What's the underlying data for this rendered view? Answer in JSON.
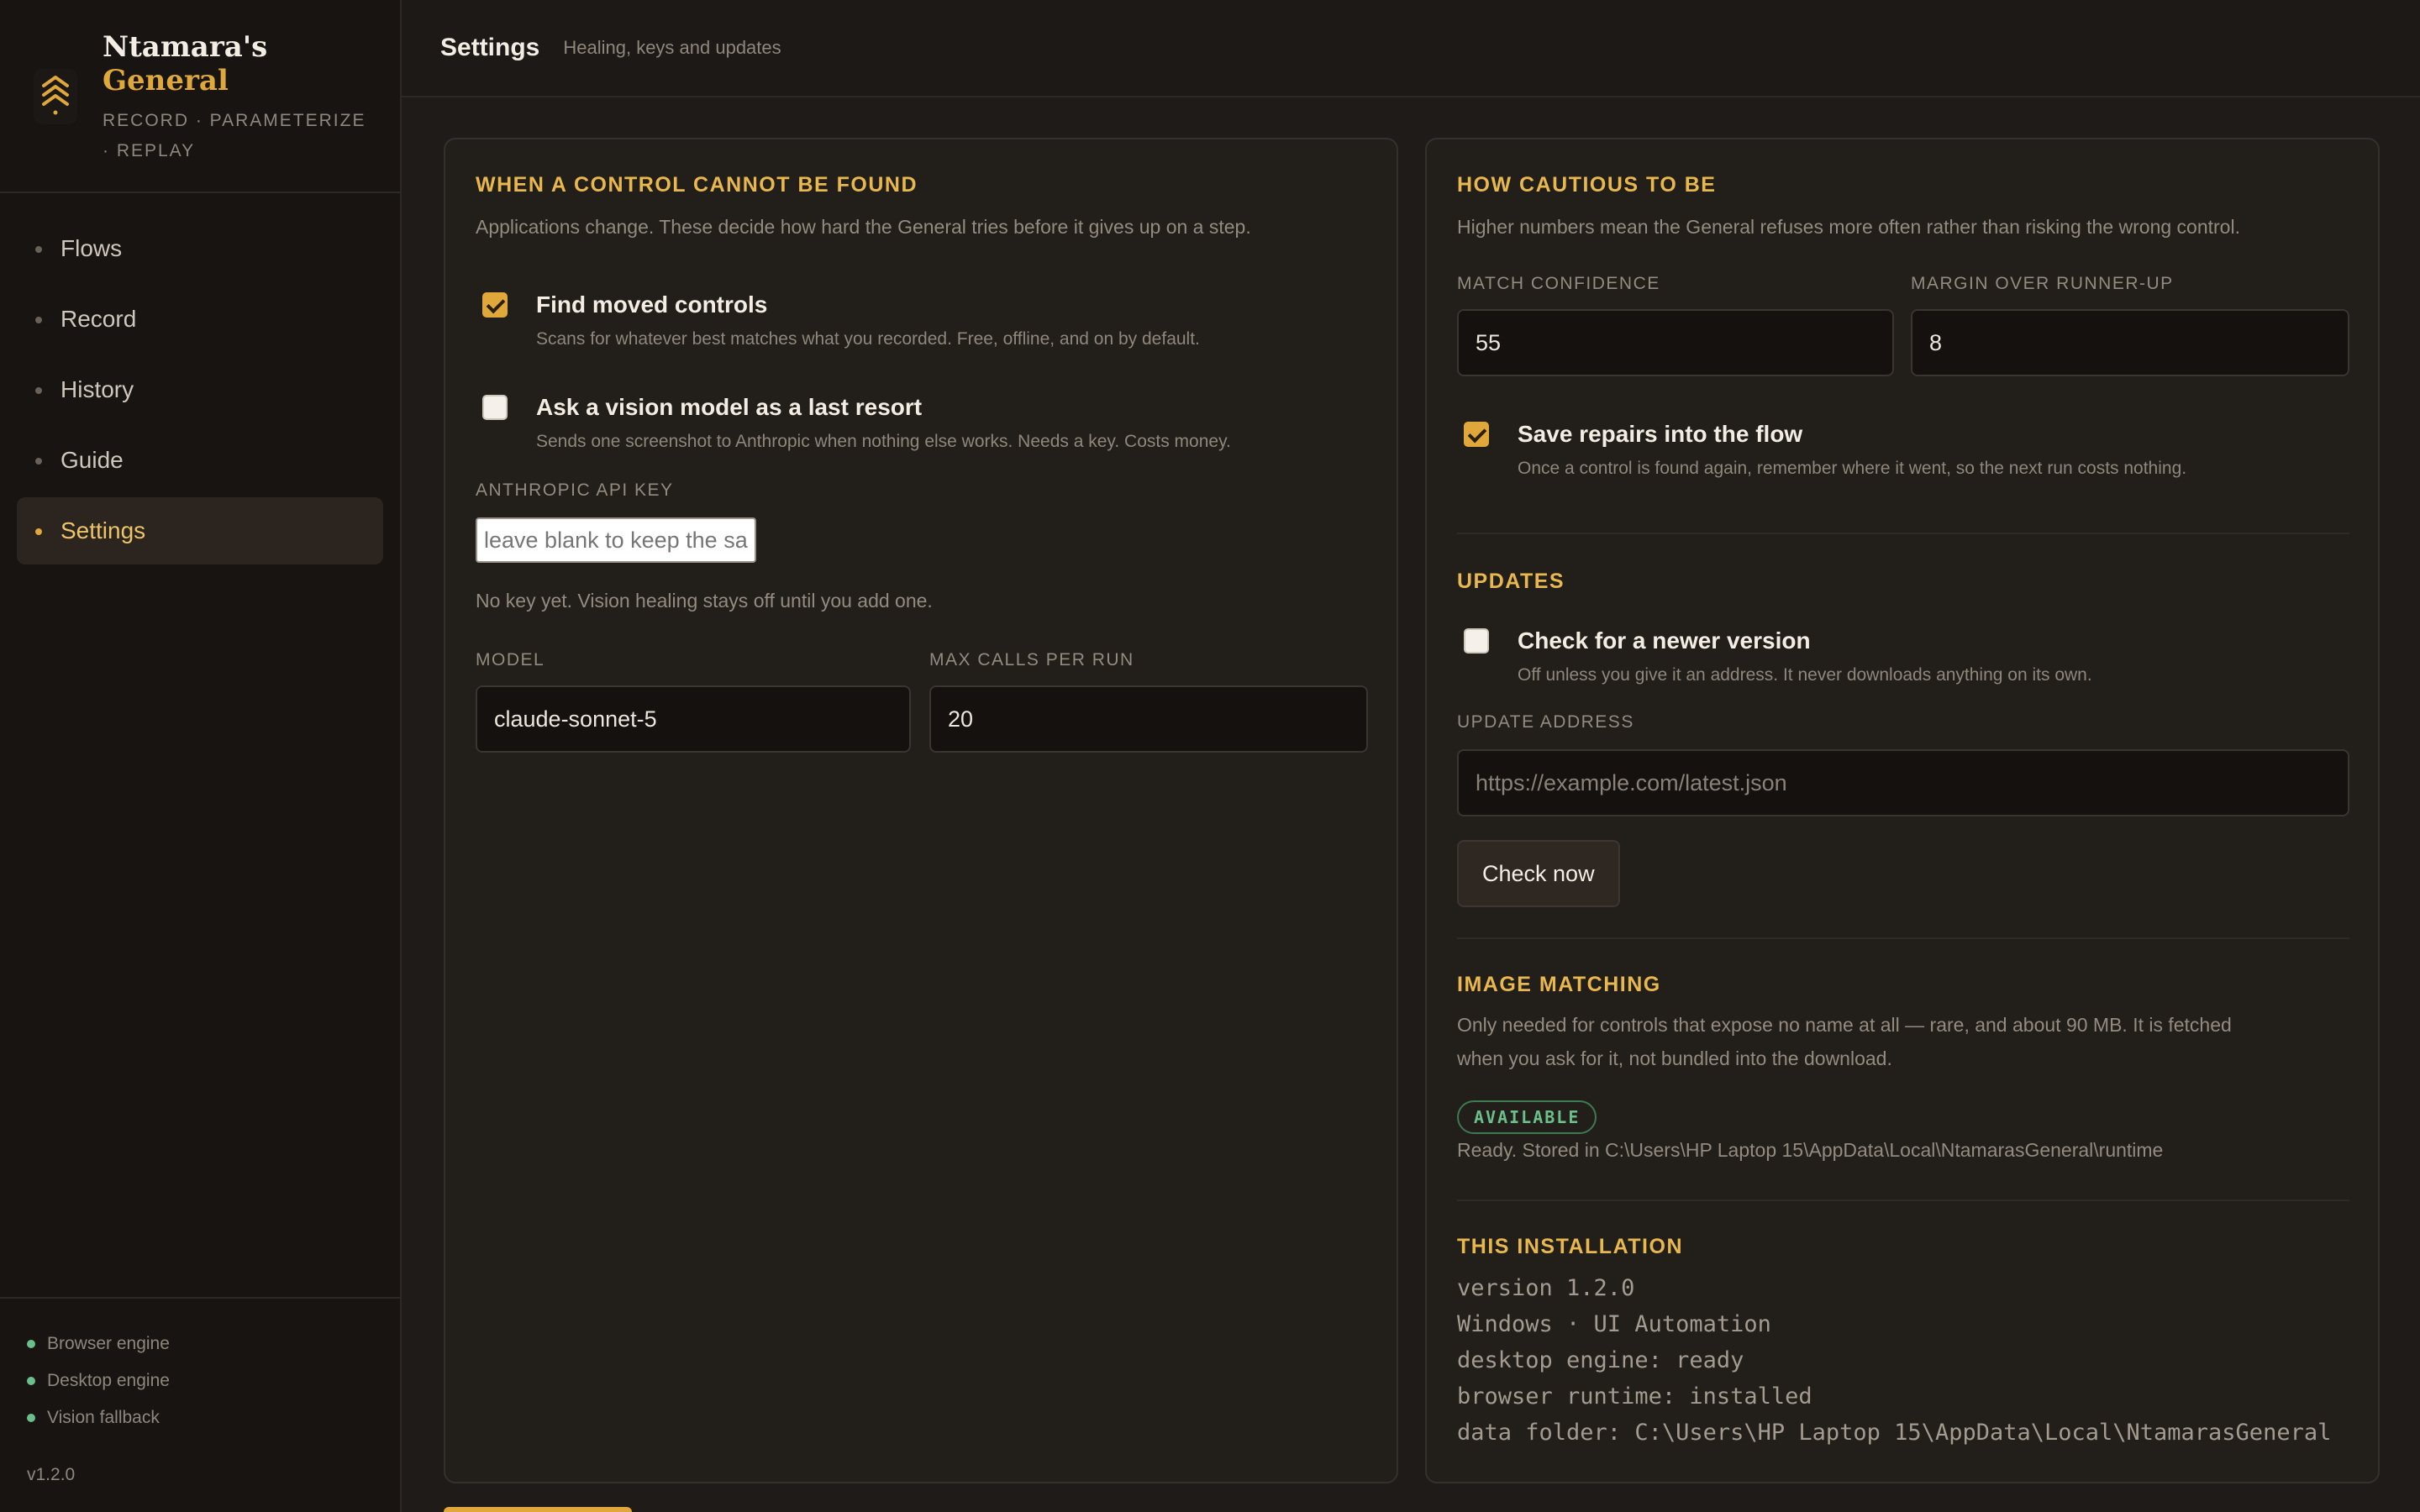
{
  "brand": {
    "name_line1": "Ntamara's",
    "name_line2": "General",
    "tagline": "RECORD · PARAMETERIZE · REPLAY"
  },
  "nav": {
    "items": [
      {
        "label": "Flows"
      },
      {
        "label": "Record"
      },
      {
        "label": "History"
      },
      {
        "label": "Guide"
      },
      {
        "label": "Settings"
      }
    ],
    "active": "Settings"
  },
  "sidebar_footer": {
    "engines": [
      "Browser engine",
      "Desktop engine",
      "Vision fallback"
    ],
    "version": "v1.2.0"
  },
  "header": {
    "title": "Settings",
    "subtitle": "Healing, keys and updates"
  },
  "healing": {
    "title": "When a control cannot be found",
    "description": "Applications change. These decide how hard the General tries before it gives up on a step.",
    "find_moved": {
      "label": "Find moved controls",
      "hint": "Scans for whatever best matches what you recorded. Free, offline, and on by default.",
      "checked": true
    },
    "vision": {
      "label": "Ask a vision model as a last resort",
      "hint": "Sends one screenshot to Anthropic when nothing else works. Needs a key. Costs money.",
      "checked": false
    },
    "api_key_label": "Anthropic API key",
    "api_key_placeholder": "leave blank to keep the saved key",
    "api_key_status": "No key yet. Vision healing stays off until you add one.",
    "model_label": "Model",
    "model_value": "claude-sonnet-5",
    "max_calls_label": "Max calls per run",
    "max_calls_value": "20"
  },
  "caution": {
    "title": "How cautious to be",
    "description": "Higher numbers mean the General refuses more often rather than risking the wrong control.",
    "confidence_label": "Match confidence",
    "confidence_value": "55",
    "margin_label": "Margin over runner-up",
    "margin_value": "8",
    "save_repairs": {
      "label": "Save repairs into the flow",
      "hint": "Once a control is found again, remember where it went, so the next run costs nothing.",
      "checked": true
    }
  },
  "updates": {
    "title": "Updates",
    "check_newer": {
      "label": "Check for a newer version",
      "hint": "Off unless you give it an address. It never downloads anything on its own.",
      "checked": false
    },
    "address_label": "Update address",
    "address_placeholder": "https://example.com/latest.json",
    "check_button": "Check now"
  },
  "image_matching": {
    "title": "Image matching",
    "description_line1": "Only needed for controls that expose no name at all — rare, and about 90 MB. It is fetched",
    "description_line2": "when you ask for it, not bundled into the download.",
    "badge": "AVAILABLE",
    "status": "Ready. Stored in C:\\Users\\HP Laptop 15\\AppData\\Local\\NtamarasGeneral\\runtime"
  },
  "installation": {
    "title": "This installation",
    "lines": [
      "version 1.2.0",
      "Windows · UI Automation",
      "desktop engine: ready",
      "browser runtime: installed",
      "data folder: C:\\Users\\HP Laptop 15\\AppData\\Local\\NtamarasGeneral"
    ]
  },
  "colors": {
    "accent": "#e0a83a",
    "section_title": "#e8b84f",
    "status_ok": "#6bbf8a",
    "background": "#1f1b18"
  }
}
